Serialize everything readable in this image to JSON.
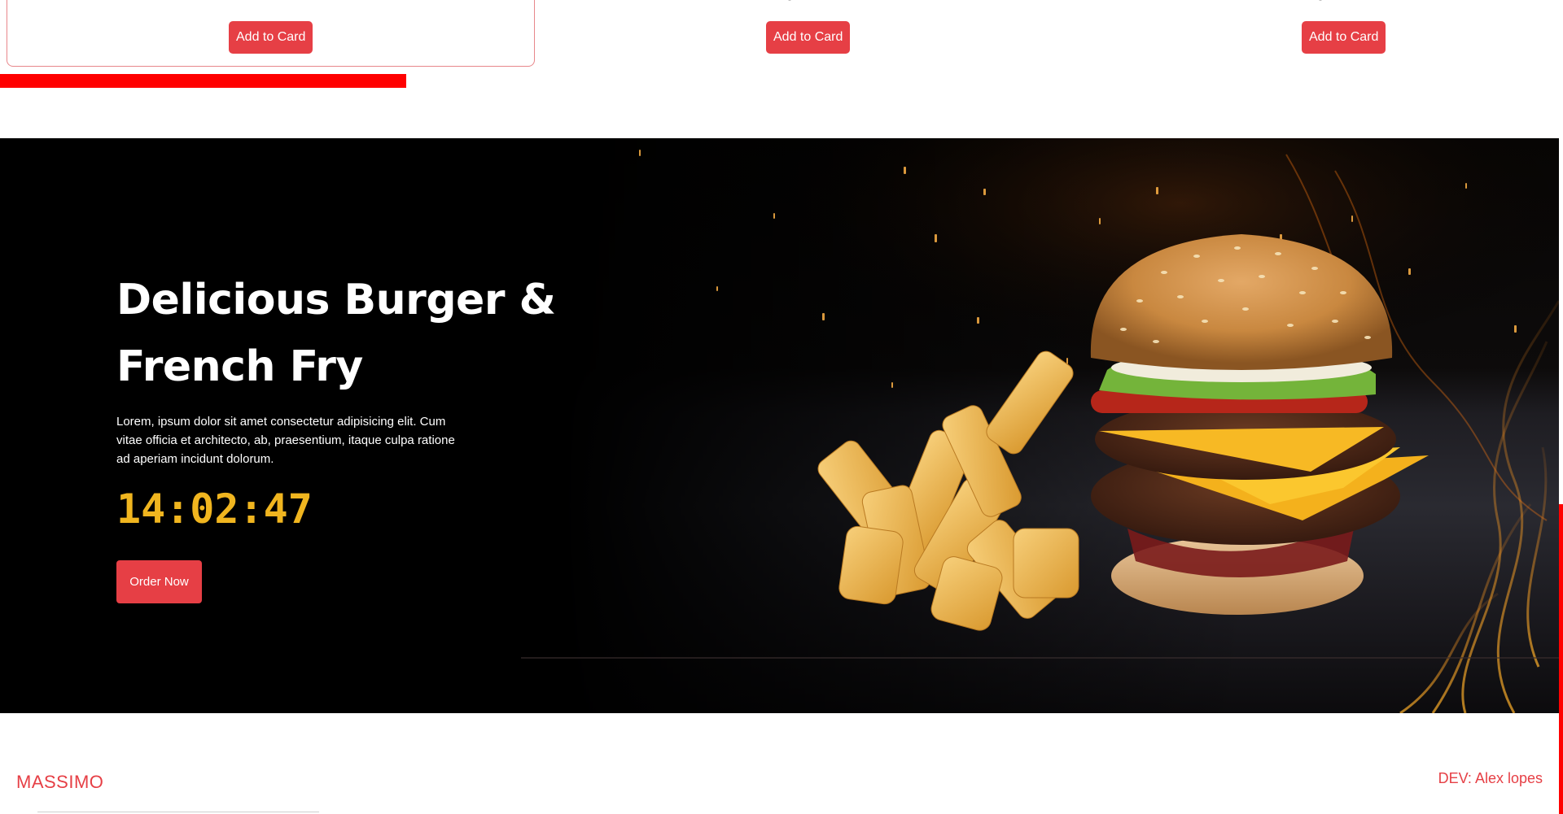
{
  "products": [
    {
      "button_label": "Add to Card"
    },
    {
      "button_label": "Add to Card"
    },
    {
      "button_label": "Add to Card"
    }
  ],
  "scroll_progress": {
    "fraction": 0.26,
    "color": "#ff0000"
  },
  "hero": {
    "title": "Delicious Burger & French Fry",
    "description": "Lorem, ipsum dolor sit amet consectetur adipisicing elit. Cum vitae officia et architecto, ab, praesentium, itaque culpa ratione ad aperiam incidunt dolorum.",
    "timer": "14:02:47",
    "order_button": "Order Now",
    "image_icon": "burger-and-fries-image"
  },
  "footer": {
    "brand": "MASSIMO",
    "developer": "DEV: Alex lopes"
  },
  "colors": {
    "accent": "#e63f45",
    "timer": "#f0b51f",
    "hero_bg": "#000000"
  }
}
